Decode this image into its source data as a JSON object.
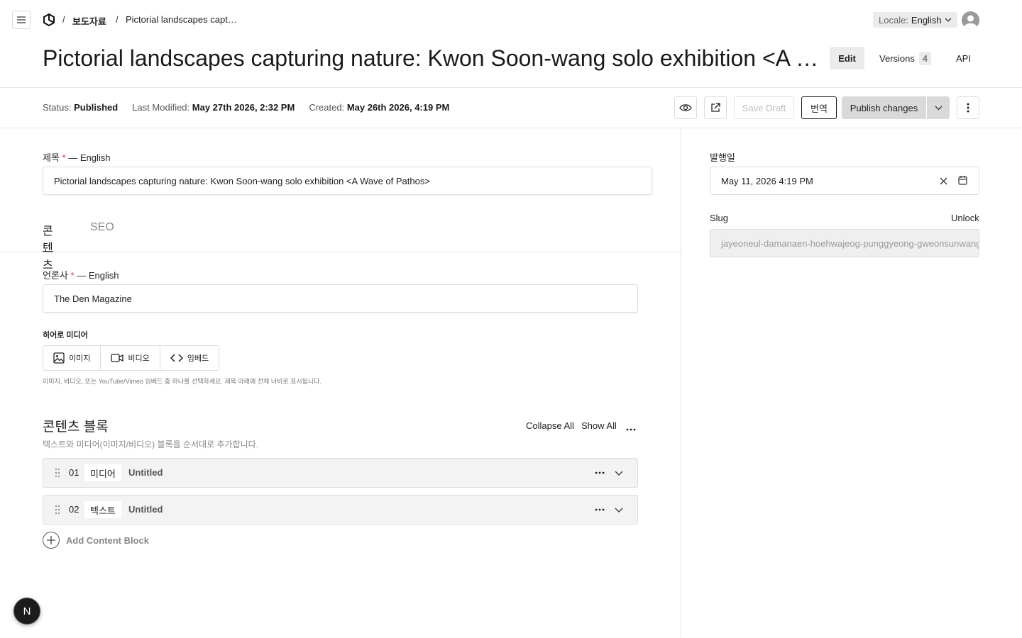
{
  "header": {
    "breadcrumb_sep": "/",
    "breadcrumb_collection": "보도자료",
    "breadcrumb_current": "Pictorial landscapes capt…",
    "locale_key": "Locale:",
    "locale_value": "English"
  },
  "document": {
    "title": "Pictorial landscapes capturing nature: Kwon Soon-wang solo exhibition <A Wave of Pathos>",
    "tabs": {
      "edit": "Edit",
      "versions": "Versions",
      "versions_count": "4",
      "api": "API"
    }
  },
  "status": {
    "status_label": "Status:",
    "status_value": "Published",
    "modified_label": "Last Modified:",
    "modified_value": "May 27th 2026, 2:32 PM",
    "created_label": "Created:",
    "created_value": "May 26th 2026, 4:19 PM"
  },
  "actions": {
    "save_draft": "Save Draft",
    "translate": "번역",
    "publish": "Publish changes"
  },
  "fields": {
    "title_label": "제목",
    "title_locale": "— English",
    "title_value": "Pictorial landscapes capturing nature: Kwon Soon-wang solo exhibition <A Wave of Pathos>",
    "tab_content": "콘텐츠",
    "tab_seo": "SEO",
    "press_label": "언론사",
    "press_locale": "— English",
    "press_value": "The Den Magazine",
    "required_mark": "*",
    "hero_label": "히어로 미디어",
    "hero_options": [
      "이미지",
      "비디오",
      "임베드"
    ],
    "hero_help": "이미지, 비디오, 또는 YouTube/Vimeo 임베드 중 하나를 선택하세요. 제목 아래에 전체 너비로 표시됩니다."
  },
  "blocks": {
    "title": "콘텐츠 블록",
    "subtitle": "텍스트와 미디어(이미지/비디오) 블록을 순서대로 추가합니다.",
    "collapse_all": "Collapse All",
    "show_all": "Show All",
    "rows": [
      {
        "num": "01",
        "type": "미디어",
        "name": "Untitled"
      },
      {
        "num": "02",
        "type": "텍스트",
        "name": "Untitled"
      }
    ],
    "add_label": "Add Content Block"
  },
  "sidebar": {
    "date_label": "발행일",
    "date_value": "May 11, 2026 4:19 PM",
    "slug_label": "Slug",
    "unlock": "Unlock",
    "slug_value": "jayeoneul-damanaen-hoehwajeog-punggyeong-gweonsunwang"
  },
  "badge": {
    "letter": "N"
  },
  "colors": {
    "required": "#d9363e",
    "publish_bg": "#d9d9d9",
    "slug_bg": "#efefef"
  }
}
